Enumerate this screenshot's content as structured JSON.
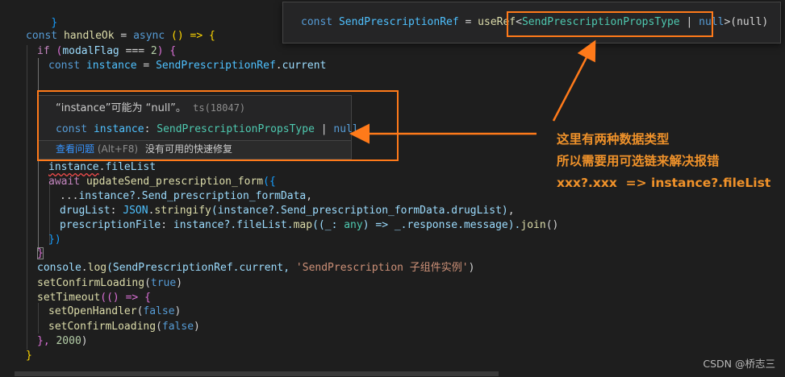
{
  "code": {
    "l0": "}",
    "l1_const": "const",
    "l1_name": "handleOk",
    "l1_eq": " = ",
    "l1_async": "async",
    "l1_rest": " () => {",
    "l2_if": "if",
    "l2_open": " (",
    "l2_var": "modalFlag",
    "l2_op": " === ",
    "l2_num": "2",
    "l2_close": ") {",
    "l3_const": "const",
    "l3_inst": "instance",
    "l3_eq": " = ",
    "l3_ref": "SendPrescriptionRef",
    "l3_dot": ".",
    "l3_current": "current",
    "l4_inst": "instance",
    "l4_dot": ".",
    "l4_prop": "fileList",
    "l5_await": "await",
    "l5_fn": "updateSend_prescription_form",
    "l5_open": "({",
    "l6_spread": "...",
    "l6_expr": "instance?.",
    "l6_prop": "Send_prescription_formData",
    "l6_comma": ",",
    "l7_key": "drugList",
    "l7_colon": ": ",
    "l7_json": "JSON",
    "l7_dot": ".",
    "l7_fn": "stringify",
    "l7_arg": "(instance?.Send_prescription_formData.drugList)",
    "l7_comma": ",",
    "l8_key": "prescriptionFile",
    "l8_colon": ": ",
    "l8_expr": "instance?.fileList.",
    "l8_map": "map",
    "l8_args": "((_: ",
    "l8_any": "any",
    "l8_arrow": ") => _.response.message).",
    "l8_join": "join",
    "l8_end": "()",
    "l9": "})",
    "l10": "}",
    "l11_console": "console",
    "l11_dot": ".",
    "l11_log": "log",
    "l11_args": "(SendPrescriptionRef.current, ",
    "l11_str": "'SendPrescription 子组件实例'",
    "l11_end": ")",
    "l12_fn": "setConfirmLoading",
    "l12_open": "(",
    "l12_val": "true",
    "l12_close": ")",
    "l13_fn": "setTimeout",
    "l13_rest": "(() => {",
    "l14_fn": "setOpenHandler",
    "l14_open": "(",
    "l14_val": "false",
    "l14_close": ")",
    "l15_fn": "setConfirmLoading",
    "l15_open": "(",
    "l15_val": "false",
    "l15_close": ")",
    "l16_close": "}, ",
    "l16_num": "2000",
    "l16_end": ")",
    "l17": "}"
  },
  "peek": {
    "const": "const",
    "name": "SendPrescriptionRef",
    "eq": " = ",
    "fn": "useRef",
    "lt": "<",
    "type": "SendPrescriptionPropsType",
    "union": " | ",
    "null": "null",
    "gt": ">",
    "arg": "(null)"
  },
  "hover": {
    "message": "“instance”可能为 “null”。",
    "code_ref": "ts(18047)",
    "decl_const": "const",
    "decl_name": "instance",
    "decl_colon": ": ",
    "decl_type": "SendPrescriptionPropsType",
    "decl_union": " | ",
    "decl_null": "null",
    "view_problem": "查看问题",
    "view_problem_hint": "(Alt+F8)",
    "no_quick_fix": "没有可用的快速修复"
  },
  "annotation": {
    "line1": "这里有两种数据类型",
    "line2": "所以需要用可选链来解决报错",
    "line3": "xxx?.xxx  => instance?.fileList"
  },
  "watermark": "CSDN @桥志三",
  "colors": {
    "annotation": "#f0922a",
    "highlight_box": "#ff7a1a",
    "background": "#1e1e1e"
  }
}
